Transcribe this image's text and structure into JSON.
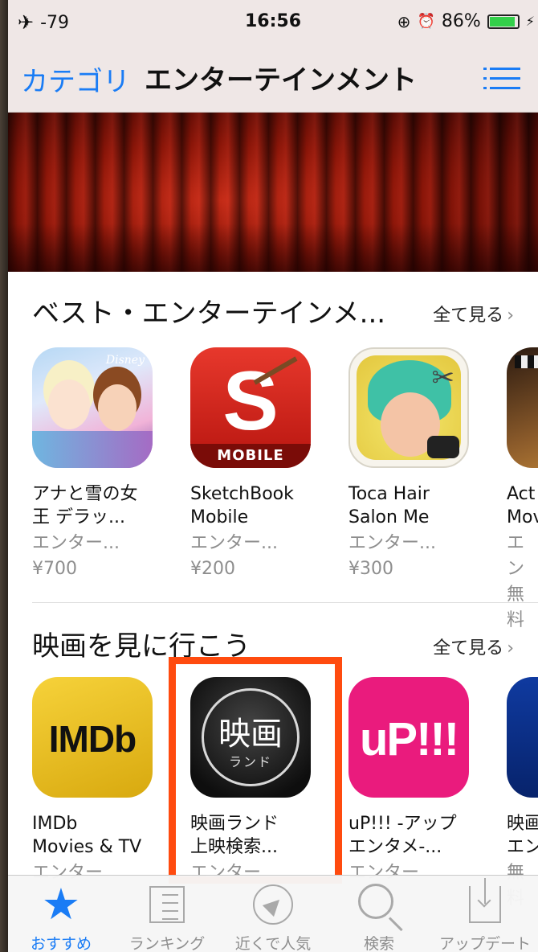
{
  "status_bar": {
    "signal": "-79",
    "time": "16:56",
    "battery_percent": "86%"
  },
  "nav": {
    "back_label": "カテゴリ",
    "title": "エンターテインメント"
  },
  "section_best": {
    "title": "ベスト・エンターテインメ...",
    "see_all": "全て見る",
    "apps": [
      {
        "name_line1": "アナと雪の女",
        "name_line2": "王 デラッ...",
        "category": "エンター...",
        "price": "¥700",
        "icon": "frozen-app-icon"
      },
      {
        "name_line1": "SketchBook",
        "name_line2": "Mobile",
        "category": "エンター...",
        "price": "¥200",
        "icon": "sketchbook-app-icon",
        "icon_text": "S",
        "icon_badge": "MOBILE"
      },
      {
        "name_line1": "Toca Hair",
        "name_line2": "Salon Me",
        "category": "エンター...",
        "price": "¥300",
        "icon": "toca-hair-app-icon"
      },
      {
        "name_line1": "Act",
        "name_line2": "Mov",
        "category": "エン",
        "price": "無料",
        "icon": "action-movie-app-icon"
      }
    ]
  },
  "section_movies": {
    "title": "映画を見に行こう",
    "see_all": "全て見る",
    "apps": [
      {
        "name_line1": "IMDb",
        "name_line2": "Movies & TV",
        "category": "エンター",
        "icon": "imdb-app-icon",
        "icon_text": "IMDb"
      },
      {
        "name_line1": "映画ランド",
        "name_line2": "上映検索...",
        "category": "エンター",
        "icon": "eiga-land-app-icon",
        "icon_text": "映画",
        "icon_sub": "ランド"
      },
      {
        "name_line1": "uP!!! -アップ",
        "name_line2": "エンタメ-...",
        "category": "エンター",
        "icon": "up-app-icon",
        "icon_text": "uP!!!"
      },
      {
        "name_line1": "映画",
        "name_line2": "エン",
        "category": "無料",
        "icon": "eiga-blue-app-icon",
        "icon_text": "映"
      }
    ]
  },
  "tabs": [
    {
      "label": "おすすめ",
      "icon": "star-icon",
      "active": true
    },
    {
      "label": "ランキング",
      "icon": "ranking-icon"
    },
    {
      "label": "近くで人気",
      "icon": "location-icon"
    },
    {
      "label": "検索",
      "icon": "search-icon"
    },
    {
      "label": "アップデート",
      "icon": "update-icon"
    }
  ],
  "colors": {
    "accent": "#1a7cf5",
    "highlight_box": "#ff4b0f"
  }
}
